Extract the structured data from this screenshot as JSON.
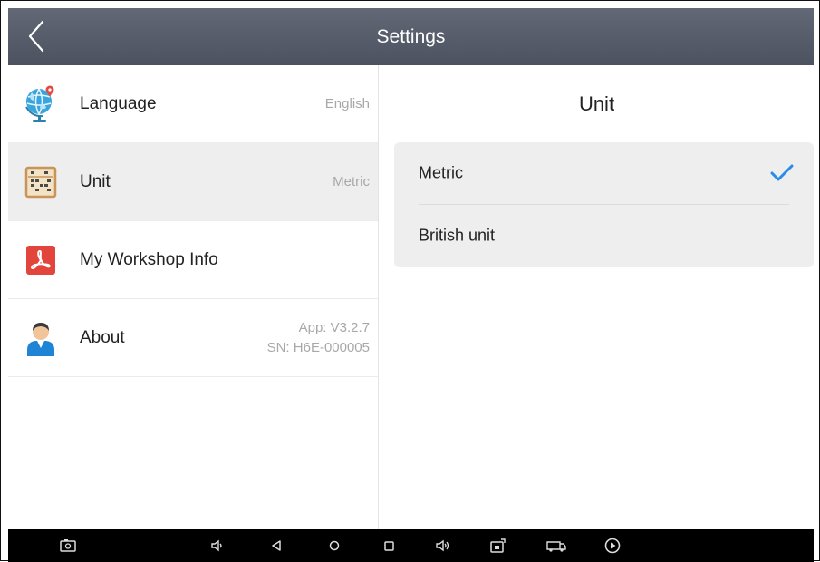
{
  "header": {
    "title": "Settings",
    "back_icon": "chevron-left-icon"
  },
  "sidebar": {
    "items": [
      {
        "label": "Language",
        "value": "English",
        "icon": "globe-icon"
      },
      {
        "label": "Unit",
        "value": "Metric",
        "icon": "abacus-icon",
        "selected": true
      },
      {
        "label": "My Workshop Info",
        "value": "",
        "icon": "pdf-icon"
      },
      {
        "label": "About",
        "value_line1": "App: V3.2.7",
        "value_line2": "SN: H6E-000005",
        "icon": "user-icon"
      }
    ]
  },
  "unit_panel": {
    "title": "Unit",
    "options": [
      {
        "label": "Metric",
        "selected": true
      },
      {
        "label": "British unit",
        "selected": false
      }
    ]
  },
  "system_bar": {
    "buttons": [
      "screenshot-icon",
      "volume-down-icon",
      "back-nav-icon",
      "home-nav-icon",
      "recent-apps-icon",
      "volume-up-icon",
      "vci-icon",
      "truck-icon",
      "play-icon"
    ]
  },
  "colors": {
    "titlebar": "#555b68",
    "selected_row": "#eeeeee",
    "checkmark": "#2a8be8",
    "pdf_red": "#e2453b",
    "system_bar": "#000000"
  }
}
